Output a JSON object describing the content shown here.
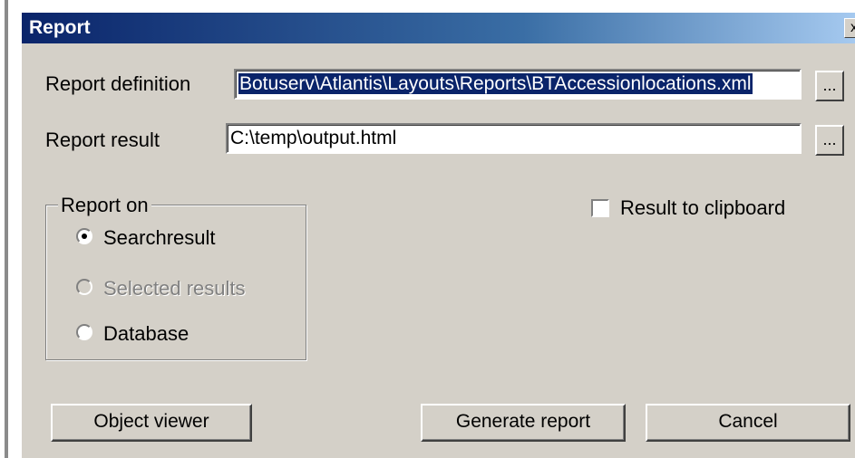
{
  "window": {
    "title": "Report",
    "close_glyph": "x"
  },
  "form": {
    "report_definition": {
      "label": "Report definition",
      "value": "Botuserv\\Atlantis\\Layouts\\Reports\\BTAccessionlocations.xml",
      "browse_label": "..."
    },
    "report_result": {
      "label": "Report result",
      "value": "C:\\temp\\output.html",
      "browse_label": "..."
    }
  },
  "report_on": {
    "legend": "Report on",
    "options": [
      {
        "label": "Searchresult",
        "selected": true,
        "enabled": true
      },
      {
        "label": "Selected results",
        "selected": false,
        "enabled": false
      },
      {
        "label": "Database",
        "selected": false,
        "enabled": true
      }
    ]
  },
  "clipboard": {
    "label": "Result to clipboard",
    "checked": false
  },
  "buttons": {
    "object_viewer": "Object viewer",
    "generate": "Generate report",
    "cancel": "Cancel"
  }
}
